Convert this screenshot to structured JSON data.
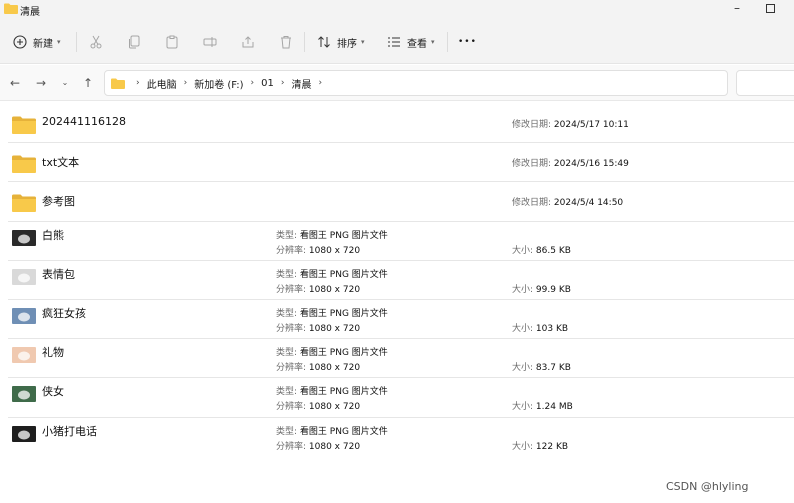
{
  "window": {
    "title": "清晨",
    "minimize_glyph": "–",
    "maximize_glyph": ""
  },
  "toolbar": {
    "new_label": "新建",
    "sort_label": "排序",
    "view_label": "查看",
    "more_glyph": "•••",
    "icons": [
      "plus-circle-icon",
      "cut-icon",
      "copy-icon",
      "paste-icon",
      "rename-icon",
      "share-icon",
      "delete-icon",
      "sort-icon",
      "view-icon",
      "more-icon"
    ]
  },
  "address": {
    "crumbs": [
      "此电脑",
      "新加卷 (F:)",
      "01",
      "清晨"
    ]
  },
  "files": [
    {
      "name": "202441116128",
      "kind": "folder",
      "date_label": "修改日期:",
      "date": "2024/5/17 10:11"
    },
    {
      "name": "txt文本",
      "kind": "folder",
      "date_label": "修改日期:",
      "date": "2024/5/16 15:49"
    },
    {
      "name": "参考图",
      "kind": "folder",
      "date_label": "修改日期:",
      "date": "2024/5/4 14:50"
    },
    {
      "name": "白熊",
      "kind": "image",
      "type_label": "类型:",
      "type": "看图王 PNG 图片文件",
      "dim_label": "分辨率:",
      "dim": "1080 x 720",
      "size_label": "大小:",
      "size": "86.5 KB",
      "thumb_color": "#2a2a2a"
    },
    {
      "name": "表情包",
      "kind": "image",
      "type_label": "类型:",
      "type": "看图王 PNG 图片文件",
      "dim_label": "分辨率:",
      "dim": "1080 x 720",
      "size_label": "大小:",
      "size": "99.9 KB",
      "thumb_color": "#d9d9d9"
    },
    {
      "name": "疯狂女孩",
      "kind": "image",
      "type_label": "类型:",
      "type": "看图王 PNG 图片文件",
      "dim_label": "分辨率:",
      "dim": "1080 x 720",
      "size_label": "大小:",
      "size": "103 KB",
      "thumb_color": "#6f8fb5"
    },
    {
      "name": "礼物",
      "kind": "image",
      "type_label": "类型:",
      "type": "看图王 PNG 图片文件",
      "dim_label": "分辨率:",
      "dim": "1080 x 720",
      "size_label": "大小:",
      "size": "83.7 KB",
      "thumb_color": "#f0c9b0"
    },
    {
      "name": "侠女",
      "kind": "image",
      "type_label": "类型:",
      "type": "看图王 PNG 图片文件",
      "dim_label": "分辨率:",
      "dim": "1080 x 720",
      "size_label": "大小:",
      "size": "1.24 MB",
      "thumb_color": "#3f6b4a"
    },
    {
      "name": "小猪打电话",
      "kind": "image",
      "type_label": "类型:",
      "type": "看图王 PNG 图片文件",
      "dim_label": "分辨率:",
      "dim": "1080 x 720",
      "size_label": "大小:",
      "size": "122 KB",
      "thumb_color": "#1e1e1e"
    }
  ],
  "colors": {
    "folder_yellow": "#f8c94a",
    "folder_back": "#e6b23a"
  },
  "watermark": "CSDN @hlyling"
}
